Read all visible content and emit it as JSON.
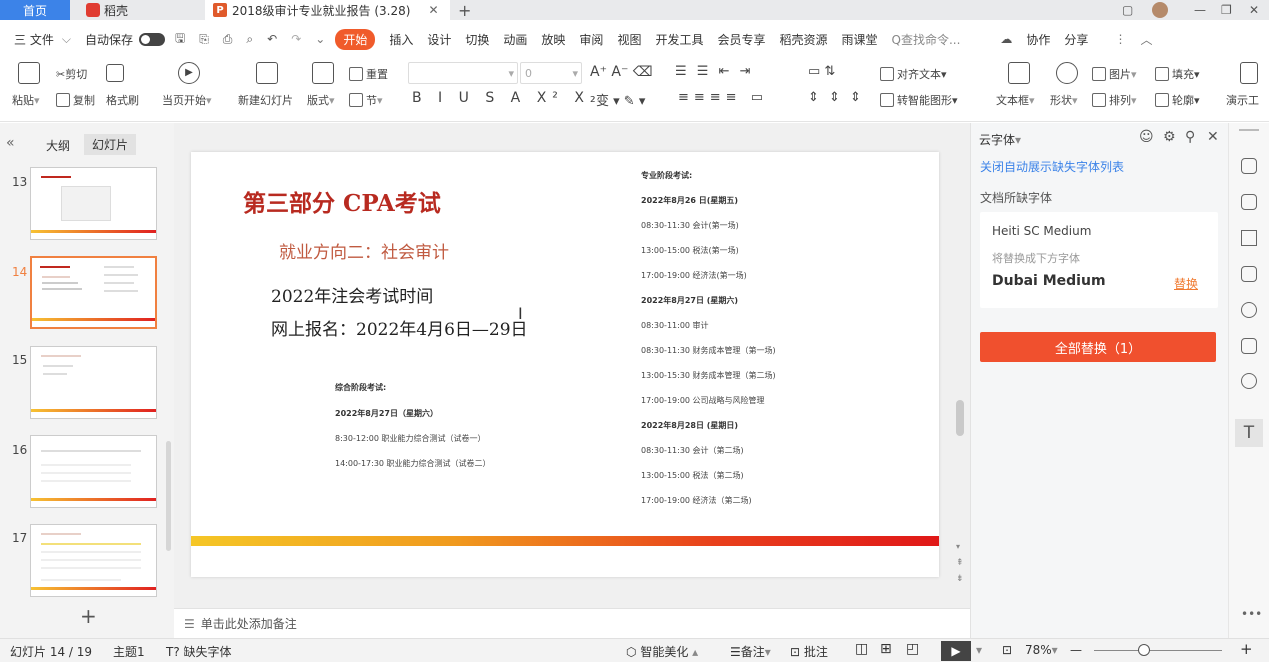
{
  "tabs": {
    "home": "首页",
    "daoke": "稻壳",
    "doc": "2018级审计专业就业报告 (3.28)",
    "add": "+"
  },
  "menu": {
    "file": "三 文件",
    "autosave": "自动保存",
    "items": [
      "开始",
      "插入",
      "设计",
      "切换",
      "动画",
      "放映",
      "审阅",
      "视图",
      "开发工具",
      "会员专享",
      "稻壳资源",
      "雨课堂"
    ],
    "search": "Q查找命令...",
    "collab": "协作",
    "share": "分享"
  },
  "ribbon": {
    "paste": "粘贴",
    "cut": "剪切",
    "copy": "复制",
    "format_painter": "格式刷",
    "from_current": "当页开始",
    "new_slide": "新建幻灯片",
    "layout": "版式",
    "section": "节",
    "reset": "重置",
    "font_size": "0",
    "align_text": "对齐文本",
    "smartart": "转智能图形",
    "textbox": "文本框",
    "shape": "形状",
    "arrange": "排列",
    "picture": "图片",
    "fill": "填充",
    "outline": "轮廓",
    "present": "演示工"
  },
  "left_panel": {
    "outline_tab": "大纲",
    "slides_tab": "幻灯片",
    "thumbs": [
      "13",
      "14",
      "15",
      "16",
      "17"
    ],
    "add": "+"
  },
  "slide": {
    "title": "第三部分 CPA考试",
    "subtitle": "就业方向二：社会审计",
    "line1": "2022年注会考试时间",
    "line2": "网上报名：2022年4月6日—29日",
    "comp_header": "综合阶段考试:",
    "comp_date": "2022年8月27日（星期六）",
    "comp_items": [
      "8:30-12:00 职业能力综合测试（试卷一）",
      "14:00-17:30 职业能力综合测试（试卷二）"
    ],
    "pro_header": "专业阶段考试:",
    "pro_rows": [
      {
        "text": "2022年8月26 日(星期五)",
        "bold": true
      },
      {
        "text": "08:30-11:30 会计(第一场)",
        "bold": false
      },
      {
        "text": "13:00-15:00 税法(第一场)",
        "bold": false
      },
      {
        "text": "17:00-19:00 经济法(第一场)",
        "bold": false
      },
      {
        "text": "2022年8月27日 (星期六)",
        "bold": true
      },
      {
        "text": "08:30-11:00 审计",
        "bold": false
      },
      {
        "text": "08:30-11:30 财务成本管理（第一场)",
        "bold": false
      },
      {
        "text": "13:00-15:30 财务成本管理（第二场)",
        "bold": false
      },
      {
        "text": "17:00-19:00 公司战略与风险管理",
        "bold": false
      },
      {
        "text": "2022年8月28日 (星期日)",
        "bold": true
      },
      {
        "text": "08:30-11:30 会计（第二场)",
        "bold": false
      },
      {
        "text": "13:00-15:00 税法（第二场)",
        "bold": false
      },
      {
        "text": "17:00-19:00 经济法（第二场)",
        "bold": false
      }
    ]
  },
  "notes": "单击此处添加备注",
  "right_panel": {
    "title": "云字体",
    "close_auto": "关闭自动展示缺失字体列表",
    "missing_fonts": "文档所缺字体",
    "font_name": "Heiti SC Medium",
    "replace_hint": "将替换成下方字体",
    "replacement": "Dubai Medium",
    "replace_link": "替换",
    "replace_all": "全部替换（1）"
  },
  "status": {
    "slide_info": "幻灯片 14 / 19",
    "theme": "主题1",
    "missing_font": "缺失字体",
    "beautify": "智能美化",
    "notes": "备注",
    "comments": "批注",
    "zoom": "78%"
  },
  "colors": {
    "accent": "#f05b2b",
    "title_red": "#c0281e",
    "link_blue": "#3c83e8"
  }
}
